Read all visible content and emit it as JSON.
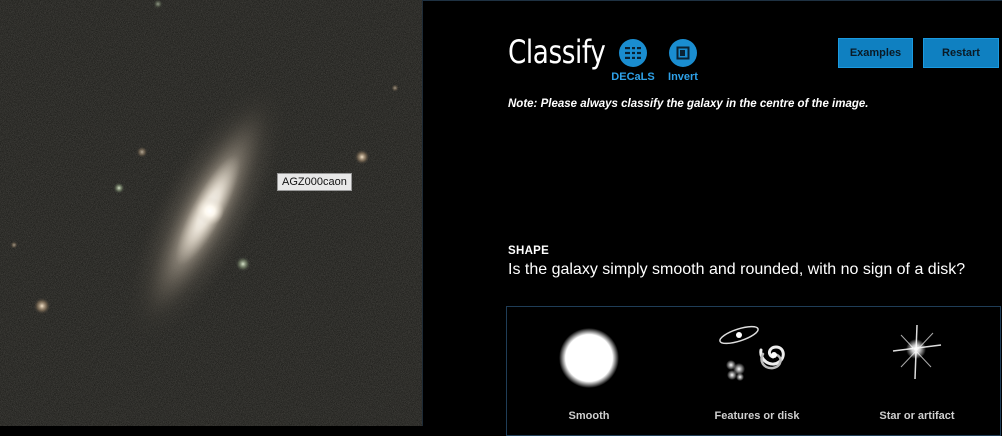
{
  "subject": {
    "id_label": "AGZ000caon"
  },
  "header": {
    "title": "Classify",
    "tools": [
      {
        "label": "DECaLS",
        "icon": "layers-icon"
      },
      {
        "label": "Invert",
        "icon": "invert-icon"
      }
    ],
    "buttons": {
      "examples": "Examples",
      "restart": "Restart"
    },
    "accent_color": "#0f80c1"
  },
  "note": "Note: Please always classify the galaxy in the centre of the image.",
  "task": {
    "label": "SHAPE",
    "question": "Is the galaxy simply smooth and rounded, with no sign of a disk?",
    "answers": [
      {
        "label": "Smooth",
        "icon": "smooth-galaxy-icon"
      },
      {
        "label": "Features or disk",
        "icon": "features-disk-icon"
      },
      {
        "label": "Star or artifact",
        "icon": "star-artifact-icon"
      }
    ]
  }
}
